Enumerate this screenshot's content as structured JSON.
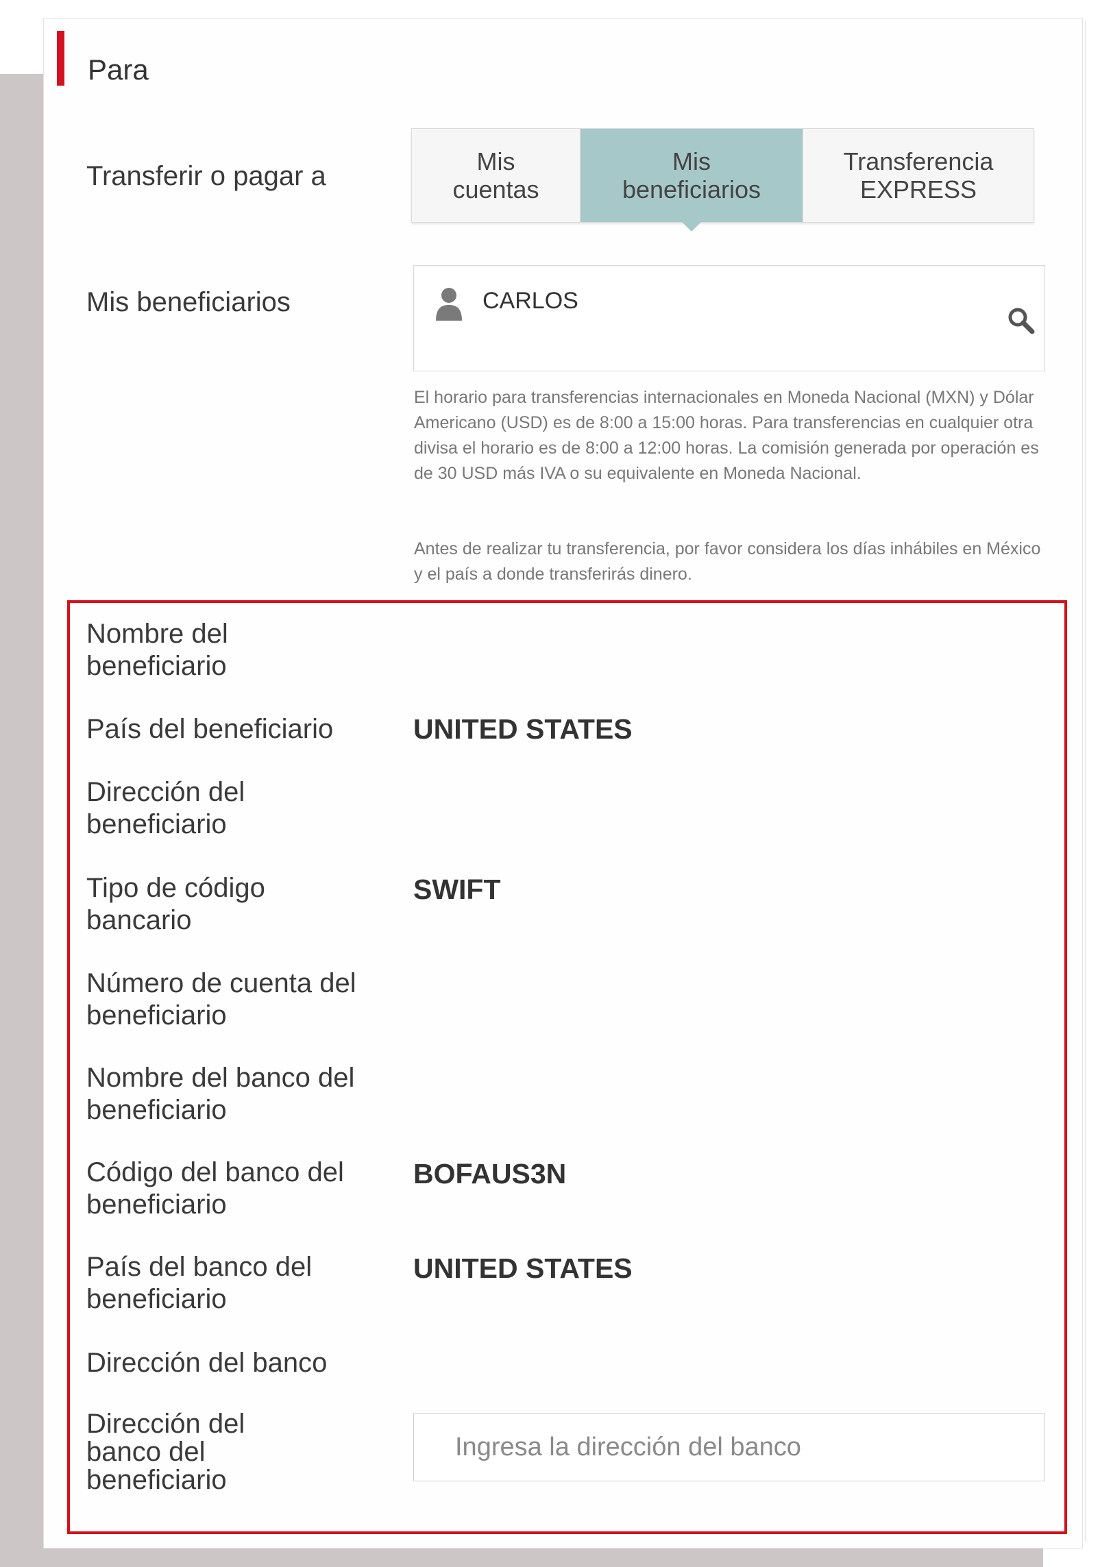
{
  "section": {
    "title": "Para"
  },
  "transfer": {
    "label": "Transferir o pagar a",
    "tabs": [
      {
        "line1": "Mis",
        "line2": "cuentas"
      },
      {
        "line1": "Mis",
        "line2": "beneficiarios"
      },
      {
        "line1": "Transferencia",
        "line2": "EXPRESS"
      }
    ],
    "selected_tab": "Mis beneficiarios"
  },
  "beneficiaries": {
    "label": "Mis beneficiarios",
    "value": "CARLOS",
    "icon": "person-icon",
    "search_icon": "search-icon"
  },
  "info": {
    "schedule": "El horario para transferencias internacionales en Moneda Nacional (MXN) y Dólar Americano (USD) es de 8:00 a 15:00 horas. Para transferencias en cualquier otra divisa el horario es de 8:00 a 12:00 horas. La comisión generada por operación es de 30 USD más IVA o su equivalente en Moneda Nacional.",
    "holidays": "Antes de realizar tu transferencia, por favor considera los días inhábiles en México y el país a donde transferirás dinero."
  },
  "details": {
    "name_label_1": "Nombre del",
    "name_label_2": "beneficiario",
    "country_label": "País del beneficiario",
    "country_value": "UNITED STATES",
    "address_label_1": "Dirección del",
    "address_label_2": "beneficiario",
    "code_type_label_1": "Tipo de código",
    "code_type_label_2": "bancario",
    "code_type_value": "SWIFT",
    "account_label_1": "Número de cuenta del",
    "account_label_2": "beneficiario",
    "bank_name_label_1": "Nombre del banco del",
    "bank_name_label_2": "beneficiario",
    "bank_code_label_1": "Código del banco del",
    "bank_code_label_2": "beneficiario",
    "bank_code_value": "BOFAUS3N",
    "bank_country_label_1": "País del banco del",
    "bank_country_label_2": "beneficiario",
    "bank_country_value": "UNITED STATES",
    "bank_address_label": "Dirección del banco",
    "beneficiary_bank_address_label_1": "Dirección del",
    "beneficiary_bank_address_label_2": "banco del",
    "beneficiary_bank_address_label_3": "beneficiario",
    "beneficiary_bank_address_placeholder": "Ingresa la dirección del banco"
  },
  "colors": {
    "accent": "#d4111e",
    "selected_tab": "#a7c8c9",
    "side_background": "#cdc6c6"
  }
}
